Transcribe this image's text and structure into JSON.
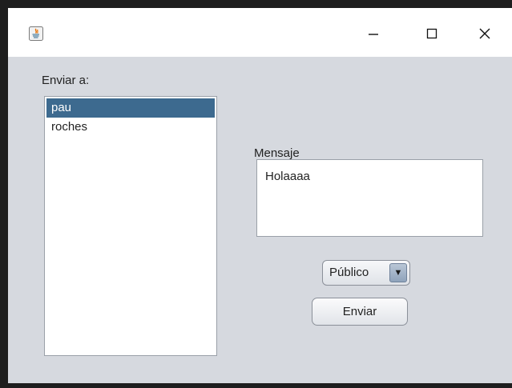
{
  "window": {
    "app_icon": "java-icon",
    "controls": {
      "minimize": "minimize-icon",
      "maximize": "maximize-icon",
      "close": "close-icon"
    }
  },
  "recipients": {
    "label": "Enviar a:",
    "items": [
      {
        "name": "pau",
        "selected": true
      },
      {
        "name": "roches",
        "selected": false
      }
    ]
  },
  "message": {
    "label": "Mensaje",
    "value": "Holaaaa"
  },
  "visibility": {
    "selected": "Público",
    "arrow": "▼"
  },
  "send_button": {
    "label": "Enviar"
  },
  "colors": {
    "window_bg": "#d6d9df",
    "selection": "#3d6a8f"
  }
}
